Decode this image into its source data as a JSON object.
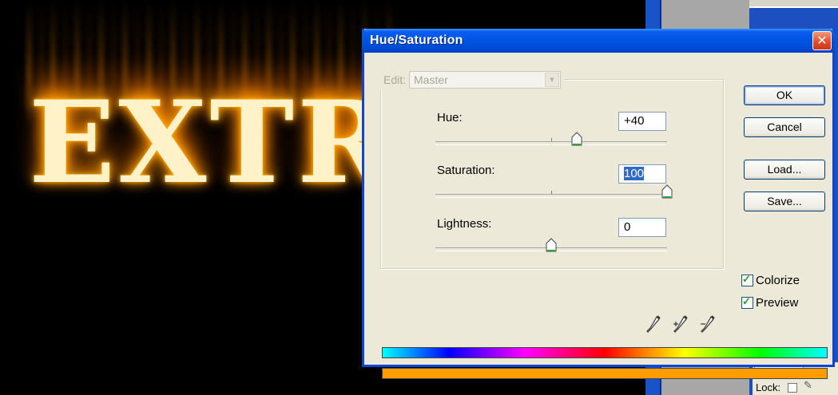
{
  "canvas": {
    "artwork_text": "EXTR"
  },
  "right_panel": {
    "lock_label": "Lock:"
  },
  "dialog": {
    "title": "Hue/Saturation",
    "close_glyph": "✕",
    "edit": {
      "label": "Edit:",
      "selected": "Master",
      "dropdown_glyph": "▾"
    },
    "hue": {
      "label": "Hue:",
      "value": "+40",
      "level": 40,
      "min": -180,
      "max": 180
    },
    "saturation": {
      "label": "Saturation:",
      "value": "100",
      "level": 100,
      "min": -100,
      "max": 100
    },
    "lightness": {
      "label": "Lightness:",
      "value": "0",
      "level": 0,
      "min": -100,
      "max": 100
    },
    "buttons": {
      "ok": "OK",
      "cancel": "Cancel",
      "load": "Load...",
      "save": "Save..."
    },
    "colorize": {
      "label": "Colorize",
      "checked": true
    },
    "preview": {
      "label": "Preview",
      "checked": true
    },
    "check_glyph": "✓",
    "icons": [
      "eyedropper-icon",
      "eyedropper-plus-icon",
      "eyedropper-minus-icon"
    ],
    "colors": {
      "result_bar": "#ff9c00",
      "accent": "#0054e3"
    }
  }
}
